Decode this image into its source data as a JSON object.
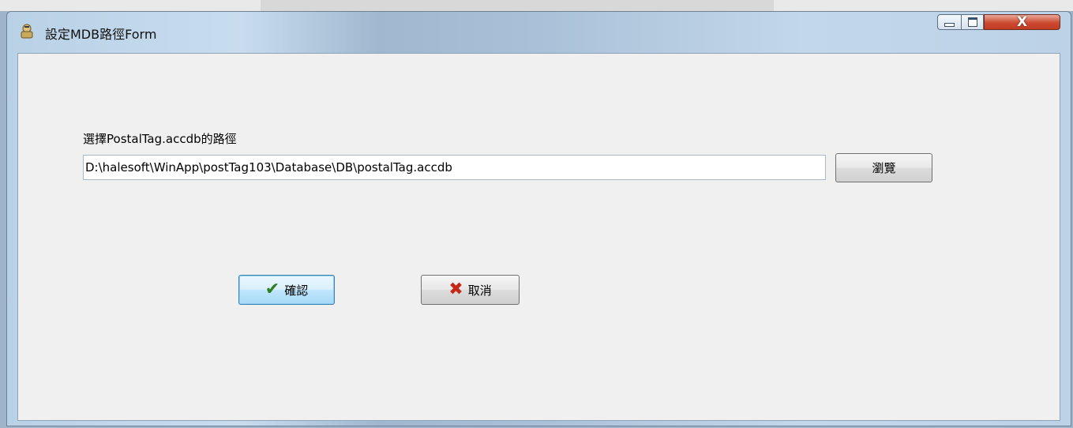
{
  "window": {
    "title": "設定MDB路徑Form",
    "controls": {
      "close_glyph": "X"
    }
  },
  "form": {
    "label": "選擇PostalTag.accdb的路徑",
    "path_value": "D:\\halesoft\\WinApp\\postTag103\\Database\\DB\\postalTag.accdb",
    "browse_label": "瀏覽",
    "ok_label": "確認",
    "cancel_label": "取消"
  },
  "icons": {
    "app": "app-icon",
    "ok": "check-icon",
    "cancel": "cross-icon"
  },
  "colors": {
    "ok_check": "#2f7d1e",
    "cancel_cross": "#c62818",
    "close_button": "#cc4a30"
  }
}
